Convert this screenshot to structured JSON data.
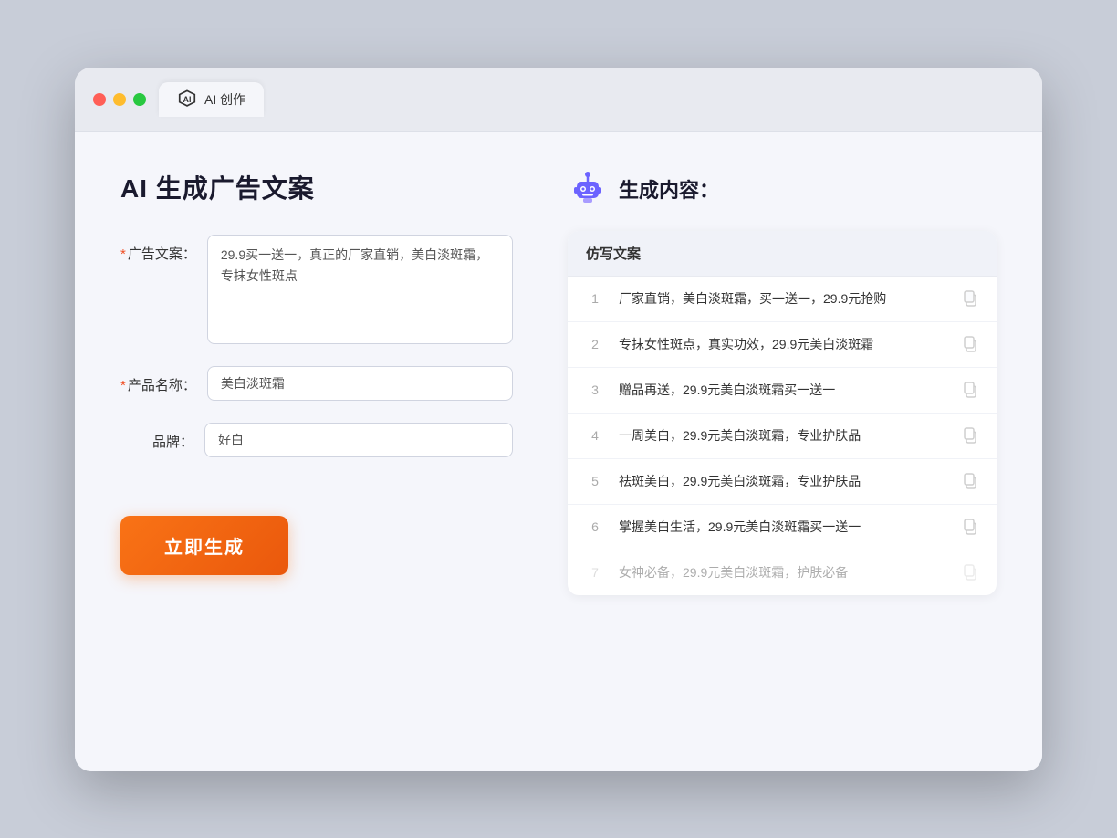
{
  "window": {
    "tab_label": "AI 创作"
  },
  "page": {
    "title": "AI 生成广告文案"
  },
  "form": {
    "ad_copy_label": "广告文案：",
    "ad_copy_required": "*",
    "ad_copy_value": "29.9买一送一，真正的厂家直销，美白淡斑霜，专抹女性斑点",
    "product_name_label": "产品名称：",
    "product_name_required": "*",
    "product_name_value": "美白淡斑霜",
    "brand_label": "品牌：",
    "brand_value": "好白",
    "generate_button": "立即生成"
  },
  "result": {
    "header": "生成内容：",
    "table_column": "仿写文案",
    "rows": [
      {
        "num": "1",
        "text": "厂家直销，美白淡斑霜，买一送一，29.9元抢购"
      },
      {
        "num": "2",
        "text": "专抹女性斑点，真实功效，29.9元美白淡斑霜"
      },
      {
        "num": "3",
        "text": "赠品再送，29.9元美白淡斑霜买一送一"
      },
      {
        "num": "4",
        "text": "一周美白，29.9元美白淡斑霜，专业护肤品"
      },
      {
        "num": "5",
        "text": "祛斑美白，29.9元美白淡斑霜，专业护肤品"
      },
      {
        "num": "6",
        "text": "掌握美白生活，29.9元美白淡斑霜买一送一"
      },
      {
        "num": "7",
        "text": "女神必备，29.9元美白淡斑霜，护肤必备",
        "faded": true
      }
    ]
  }
}
